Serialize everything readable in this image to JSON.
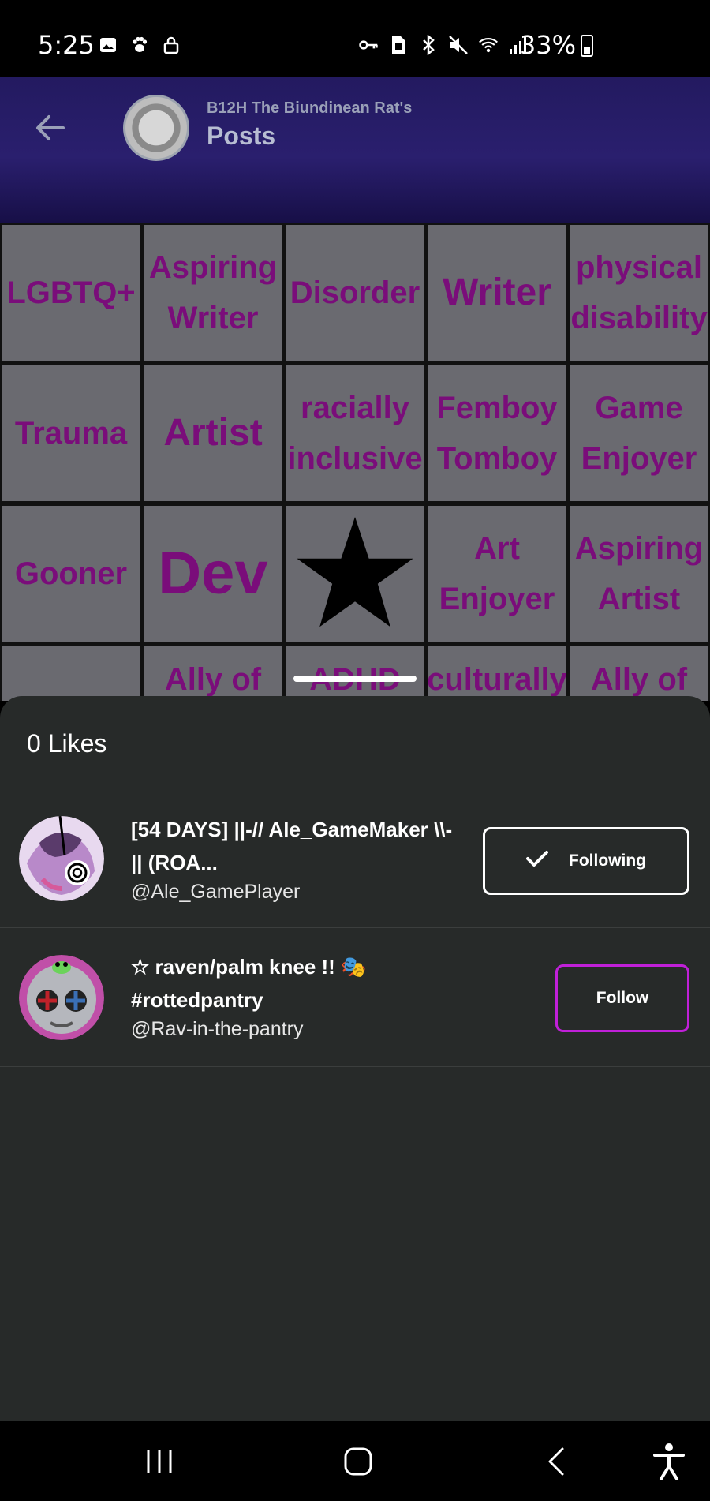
{
  "status_bar": {
    "time": "5:25",
    "battery": "33%"
  },
  "post_header": {
    "subtitle": "B12H The Biundinean Rat's",
    "title": "Posts"
  },
  "bingo": [
    "LGBTQ+",
    "Aspiring Writer",
    "Disorder",
    "Writer",
    "physical disability",
    "Trauma",
    "Artist",
    "racially inclusive",
    "Femboy Tomboy",
    "Game Enjoyer",
    "Gooner",
    "Dev",
    "",
    "Art Enjoyer",
    "Aspiring Artist",
    "",
    "Ally of",
    "ADHD",
    "culturally",
    "Ally of"
  ],
  "sheet": {
    "title": "0 Likes",
    "users": [
      {
        "name": "[54 DAYS] ||-// Ale_GameMaker \\\\-|| (ROA...",
        "handle": "@Ale_GamePlayer",
        "button": "Following"
      },
      {
        "name": "☆ raven/palm knee !! 🎭 #rottedpantry",
        "handle": "@Rav-in-the-pantry",
        "button": "Follow"
      }
    ]
  },
  "colors": {
    "accent": "#c020d8",
    "sheet_bg": "#272a29",
    "bingo_text": "#7a0d7a"
  }
}
